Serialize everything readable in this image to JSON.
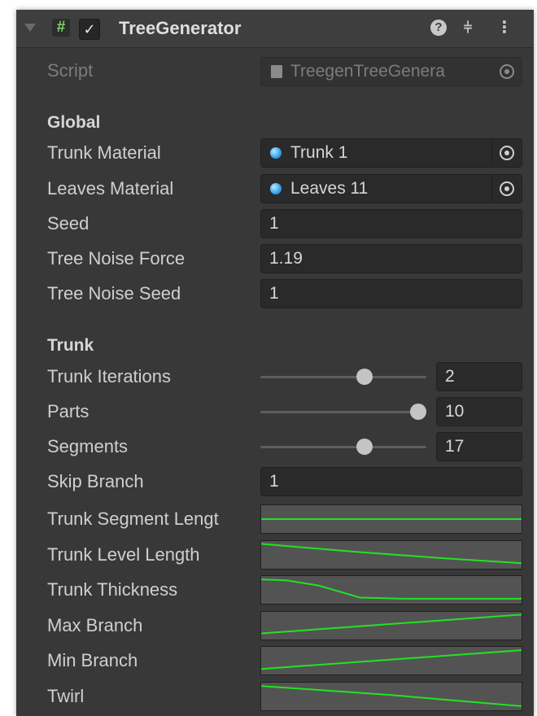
{
  "component": {
    "title": "TreeGenerator",
    "enabled": true,
    "icons": [
      "script-hash-icon",
      "help-icon",
      "presets-icon",
      "kebab-menu-icon"
    ]
  },
  "script_row": {
    "label": "Script",
    "value": "TreegenTreeGenera"
  },
  "global": {
    "header": "Global",
    "trunk_material": {
      "label": "Trunk Material",
      "value": "Trunk 1"
    },
    "leaves_material": {
      "label": "Leaves Material",
      "value": "Leaves 11"
    },
    "seed": {
      "label": "Seed",
      "value": "1"
    },
    "tree_noise_force": {
      "label": "Tree Noise Force",
      "value": "1.19"
    },
    "tree_noise_seed": {
      "label": "Tree Noise Seed",
      "value": "1"
    }
  },
  "trunk": {
    "header": "Trunk",
    "trunk_iterations": {
      "label": "Trunk Iterations",
      "value": "2",
      "slider_fraction": 0.66
    },
    "parts": {
      "label": "Parts",
      "value": "10",
      "slider_fraction": 1.0
    },
    "segments": {
      "label": "Segments",
      "value": "17",
      "slider_fraction": 0.66
    },
    "skip_branch": {
      "label": "Skip Branch",
      "value": "1"
    },
    "curves": [
      {
        "label": "Trunk Segment Lengt",
        "points": [
          [
            0,
            0.5
          ],
          [
            1,
            0.5
          ]
        ]
      },
      {
        "label": "Trunk Level Length",
        "points": [
          [
            0,
            0.9
          ],
          [
            0.35,
            0.62
          ],
          [
            0.7,
            0.38
          ],
          [
            1,
            0.2
          ]
        ]
      },
      {
        "label": "Trunk Thickness",
        "points": [
          [
            0,
            0.88
          ],
          [
            0.1,
            0.84
          ],
          [
            0.22,
            0.66
          ],
          [
            0.38,
            0.22
          ],
          [
            0.55,
            0.18
          ],
          [
            1,
            0.18
          ]
        ]
      },
      {
        "label": "Max Branch",
        "points": [
          [
            0,
            0.22
          ],
          [
            1,
            0.9
          ]
        ]
      },
      {
        "label": "Min Branch",
        "points": [
          [
            0,
            0.2
          ],
          [
            1,
            0.88
          ]
        ]
      },
      {
        "label": "Twirl",
        "points": [
          [
            0,
            0.88
          ],
          [
            0.5,
            0.55
          ],
          [
            1,
            0.15
          ]
        ]
      }
    ]
  },
  "colors": {
    "panel": "#383838",
    "field": "#2a2a2a",
    "curve_bg": "#535353",
    "curve_line": "#21e321",
    "script_hash": "#7fd36a",
    "material_dot": "#3aa8f0"
  }
}
